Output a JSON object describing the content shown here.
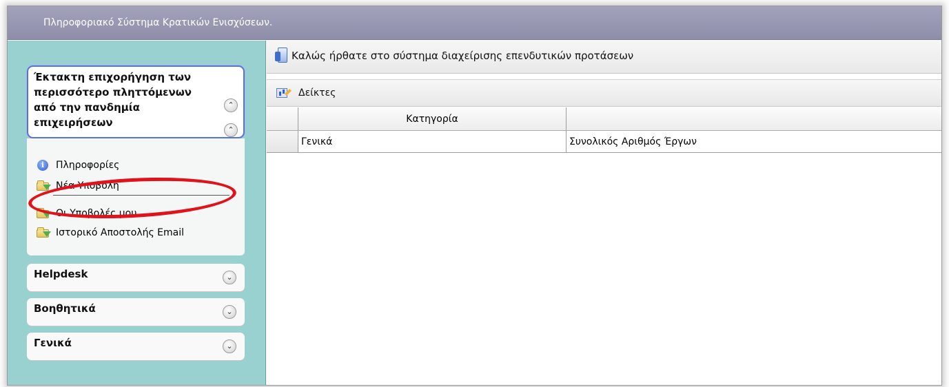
{
  "app": {
    "title": "Πληροφοριακό Σύστημα Κρατικών Ενισχύσεων."
  },
  "sidebar": {
    "active_panel": {
      "title_lines": [
        "Έκτακτη επιχορήγηση των",
        "περισσότερο πληττόμενων",
        "από την πανδημία",
        "επιχειρήσεων"
      ],
      "items": [
        {
          "label": "Πληροφορίες",
          "icon": "info-icon"
        },
        {
          "label": "Νέα Υποβολή",
          "icon": "folder-arrow-icon"
        },
        {
          "label": "Οι Υποβολές μου",
          "icon": "folder-arrow-icon"
        },
        {
          "label": "Ιστορικό Αποστολής Email",
          "icon": "folder-arrow-icon"
        }
      ]
    },
    "collapsed_panels": [
      {
        "label": "Helpdesk"
      },
      {
        "label": "Βοηθητικά"
      },
      {
        "label": "Γενικά"
      }
    ],
    "highlight_color": "#e0121a"
  },
  "main": {
    "welcome": "Καλώς ήρθατε στο σύστημα διαχείρισης επενδυτικών προτάσεων",
    "toolbar": {
      "indicators_label": "Δείκτες"
    },
    "grid": {
      "columns": [
        "",
        "Κατηγορία",
        ""
      ],
      "rows": [
        [
          "",
          "Γενικά",
          "Συνολικός Αριθμός Έργων"
        ]
      ]
    }
  },
  "colors": {
    "titlebar": "#9a9ab4",
    "sidebar": "#99d1d1",
    "panel_border": "#5a6fe0"
  }
}
